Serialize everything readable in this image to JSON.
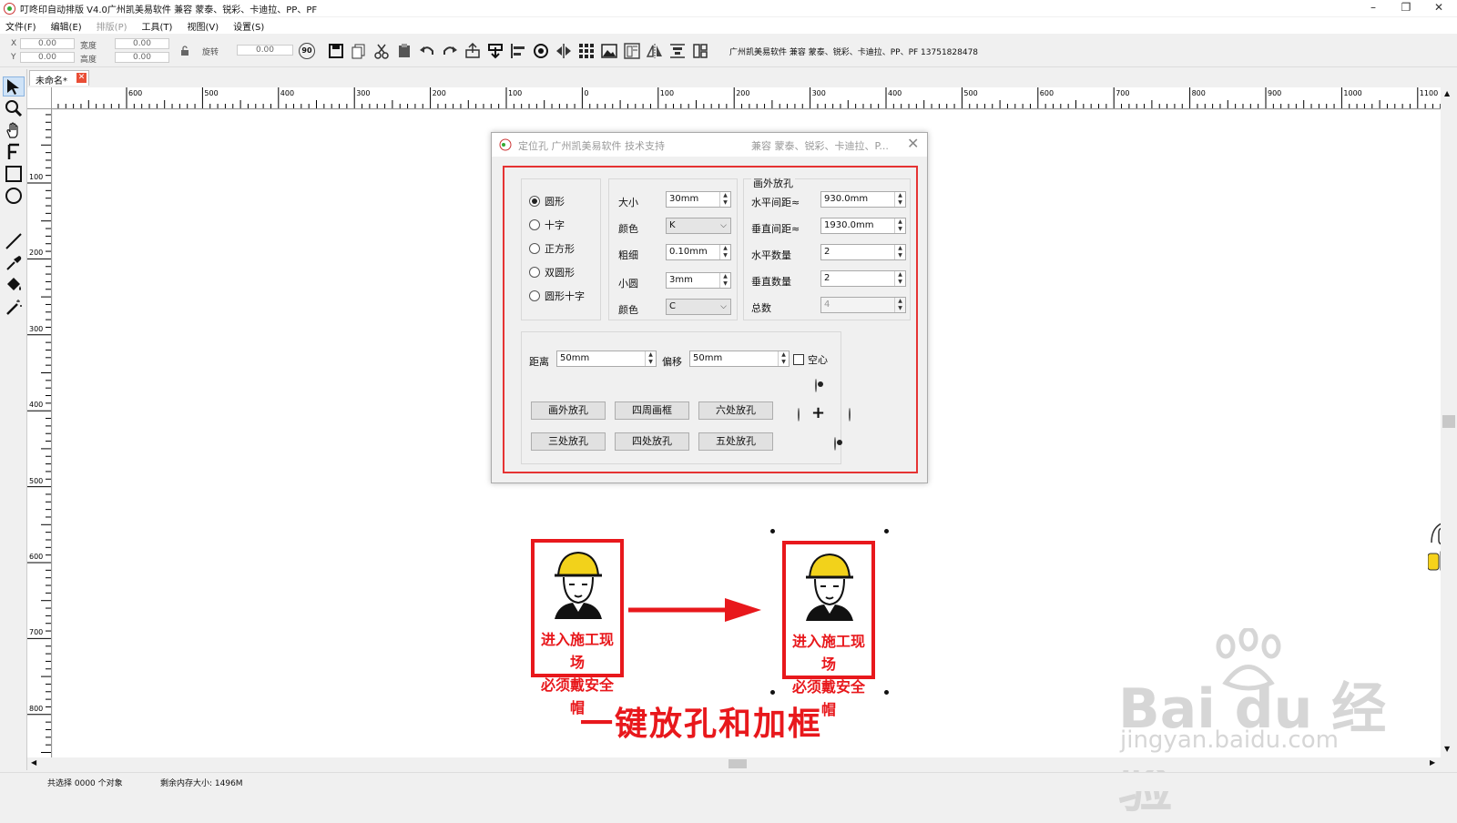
{
  "window": {
    "title": "叮咚印自动排版 V4.0广州凯美易软件 兼容 蒙泰、锐彩、卡迪拉、PP、PF",
    "minimize": "–",
    "restore": "❐",
    "close": "✕"
  },
  "menu": [
    "文件(F)",
    "编辑(E)",
    "排版(P)",
    "工具(T)",
    "视图(V)",
    "设置(S)"
  ],
  "toolbar": {
    "x_label": "X",
    "x_value": "0.00",
    "y_label": "Y",
    "y_value": "0.00",
    "width_label": "宽度",
    "width_value": "0.00",
    "height_label": "高度",
    "height_value": "0.00",
    "rotate_label": "旋转",
    "rotate_value": "0.00",
    "rotate90": "90",
    "info": "广州凯美易软件 兼容 蒙泰、锐彩、卡迪拉、PP、PF  13751828478"
  },
  "tab": {
    "label": "未命名*",
    "close": "✕"
  },
  "ruler": {
    "h_labels": [
      "600",
      "500",
      "400",
      "300",
      "200",
      "100",
      "0",
      "100",
      "200",
      "300",
      "400",
      "500",
      "600",
      "700",
      "800",
      "900",
      "1000",
      "1100"
    ],
    "v_labels": [
      "100",
      "200",
      "300",
      "400",
      "500",
      "600",
      "700",
      "800"
    ]
  },
  "dialog": {
    "title": "定位孔 广州凯美易软件 技术支持",
    "title_right": "兼容 蒙泰、锐彩、卡迪拉、P...",
    "close": "✕",
    "shapes": [
      "圆形",
      "十字",
      "正方形",
      "双圆形",
      "圆形十字"
    ],
    "size_label": "大小",
    "size_value": "30mm",
    "color_label": "颜色",
    "color_value": "K",
    "thickness_label": "粗细",
    "thickness_value": "0.10mm",
    "small_circle_label": "小圆",
    "small_circle_value": "3mm",
    "color2_label": "颜色",
    "color2_value": "C",
    "group_title": "画外放孔",
    "h_spacing_label": "水平间距≈",
    "h_spacing_value": "930.0mm",
    "v_spacing_label": "垂直间距≈",
    "v_spacing_value": "1930.0mm",
    "h_count_label": "水平数量",
    "h_count_value": "2",
    "v_count_label": "垂直数量",
    "v_count_value": "2",
    "total_label": "总数",
    "total_value": "4",
    "distance_label": "距离",
    "distance_value": "50mm",
    "offset_label": "偏移",
    "offset_value": "50mm",
    "hollow_label": "空心",
    "buttons": [
      "画外放孔",
      "四周画框",
      "六处放孔",
      "三处放孔",
      "四处放孔",
      "五处放孔"
    ]
  },
  "canvas": {
    "sign_text_line1": "进入施工现场",
    "sign_text_line2": "必须戴安全帽",
    "caption": "一键放孔和加框",
    "assistant_label": "小"
  },
  "watermark": {
    "line1": "Bai du 经验",
    "line2": "jingyan.baidu.com"
  },
  "status": {
    "selection": "共选择 0000 个对象",
    "memory": "剩余内存大小: 1496M"
  },
  "colors": {
    "accent_red": "#e53333",
    "sign_red": "#e8181c",
    "helmet_yellow": "#f2d21b"
  }
}
